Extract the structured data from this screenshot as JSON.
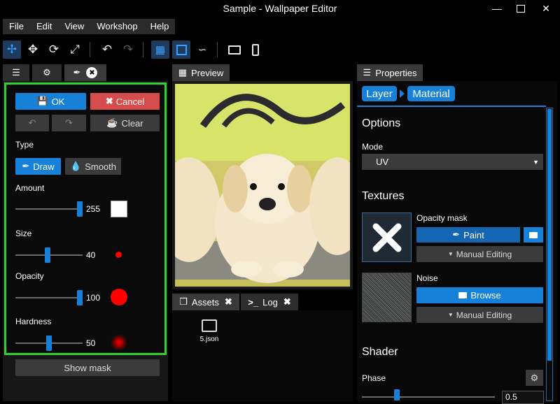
{
  "window": {
    "title": "Sample - Wallpaper Editor",
    "controls": [
      "minimize-icon",
      "maximize-icon",
      "close-icon"
    ]
  },
  "menu": [
    "File",
    "Edit",
    "View",
    "Workshop",
    "Help"
  ],
  "left": {
    "tab_close": "✖",
    "ok": "OK",
    "cancel": "Cancel",
    "clear": "Clear",
    "type_label": "Type",
    "draw": "Draw",
    "smooth": "Smooth",
    "amount_label": "Amount",
    "amount_value": "255",
    "size_label": "Size",
    "size_value": "40",
    "opacity_label": "Opacity",
    "opacity_value": "100",
    "hardness_label": "Hardness",
    "hardness_value": "50",
    "show_mask": "Show mask",
    "colors": {
      "accent": "#1780d8",
      "brush_red": "#ff0000",
      "focus_border": "#2fd12f"
    }
  },
  "preview": {
    "tab": "Preview"
  },
  "assets": {
    "tab": "Assets",
    "log_tab": "Log",
    "file": "5.json"
  },
  "props": {
    "tab": "Properties",
    "crumb1": "Layer",
    "crumb2": "Material",
    "options": "Options",
    "mode_label": "Mode",
    "mode_value": "UV",
    "textures": "Textures",
    "opacity_mask": "Opacity mask",
    "paint": "Paint",
    "manual1": "Manual Editing",
    "noise": "Noise",
    "browse": "Browse",
    "manual2": "Manual Editing",
    "shader": "Shader",
    "phase_label": "Phase",
    "phase_value": "0.5"
  }
}
